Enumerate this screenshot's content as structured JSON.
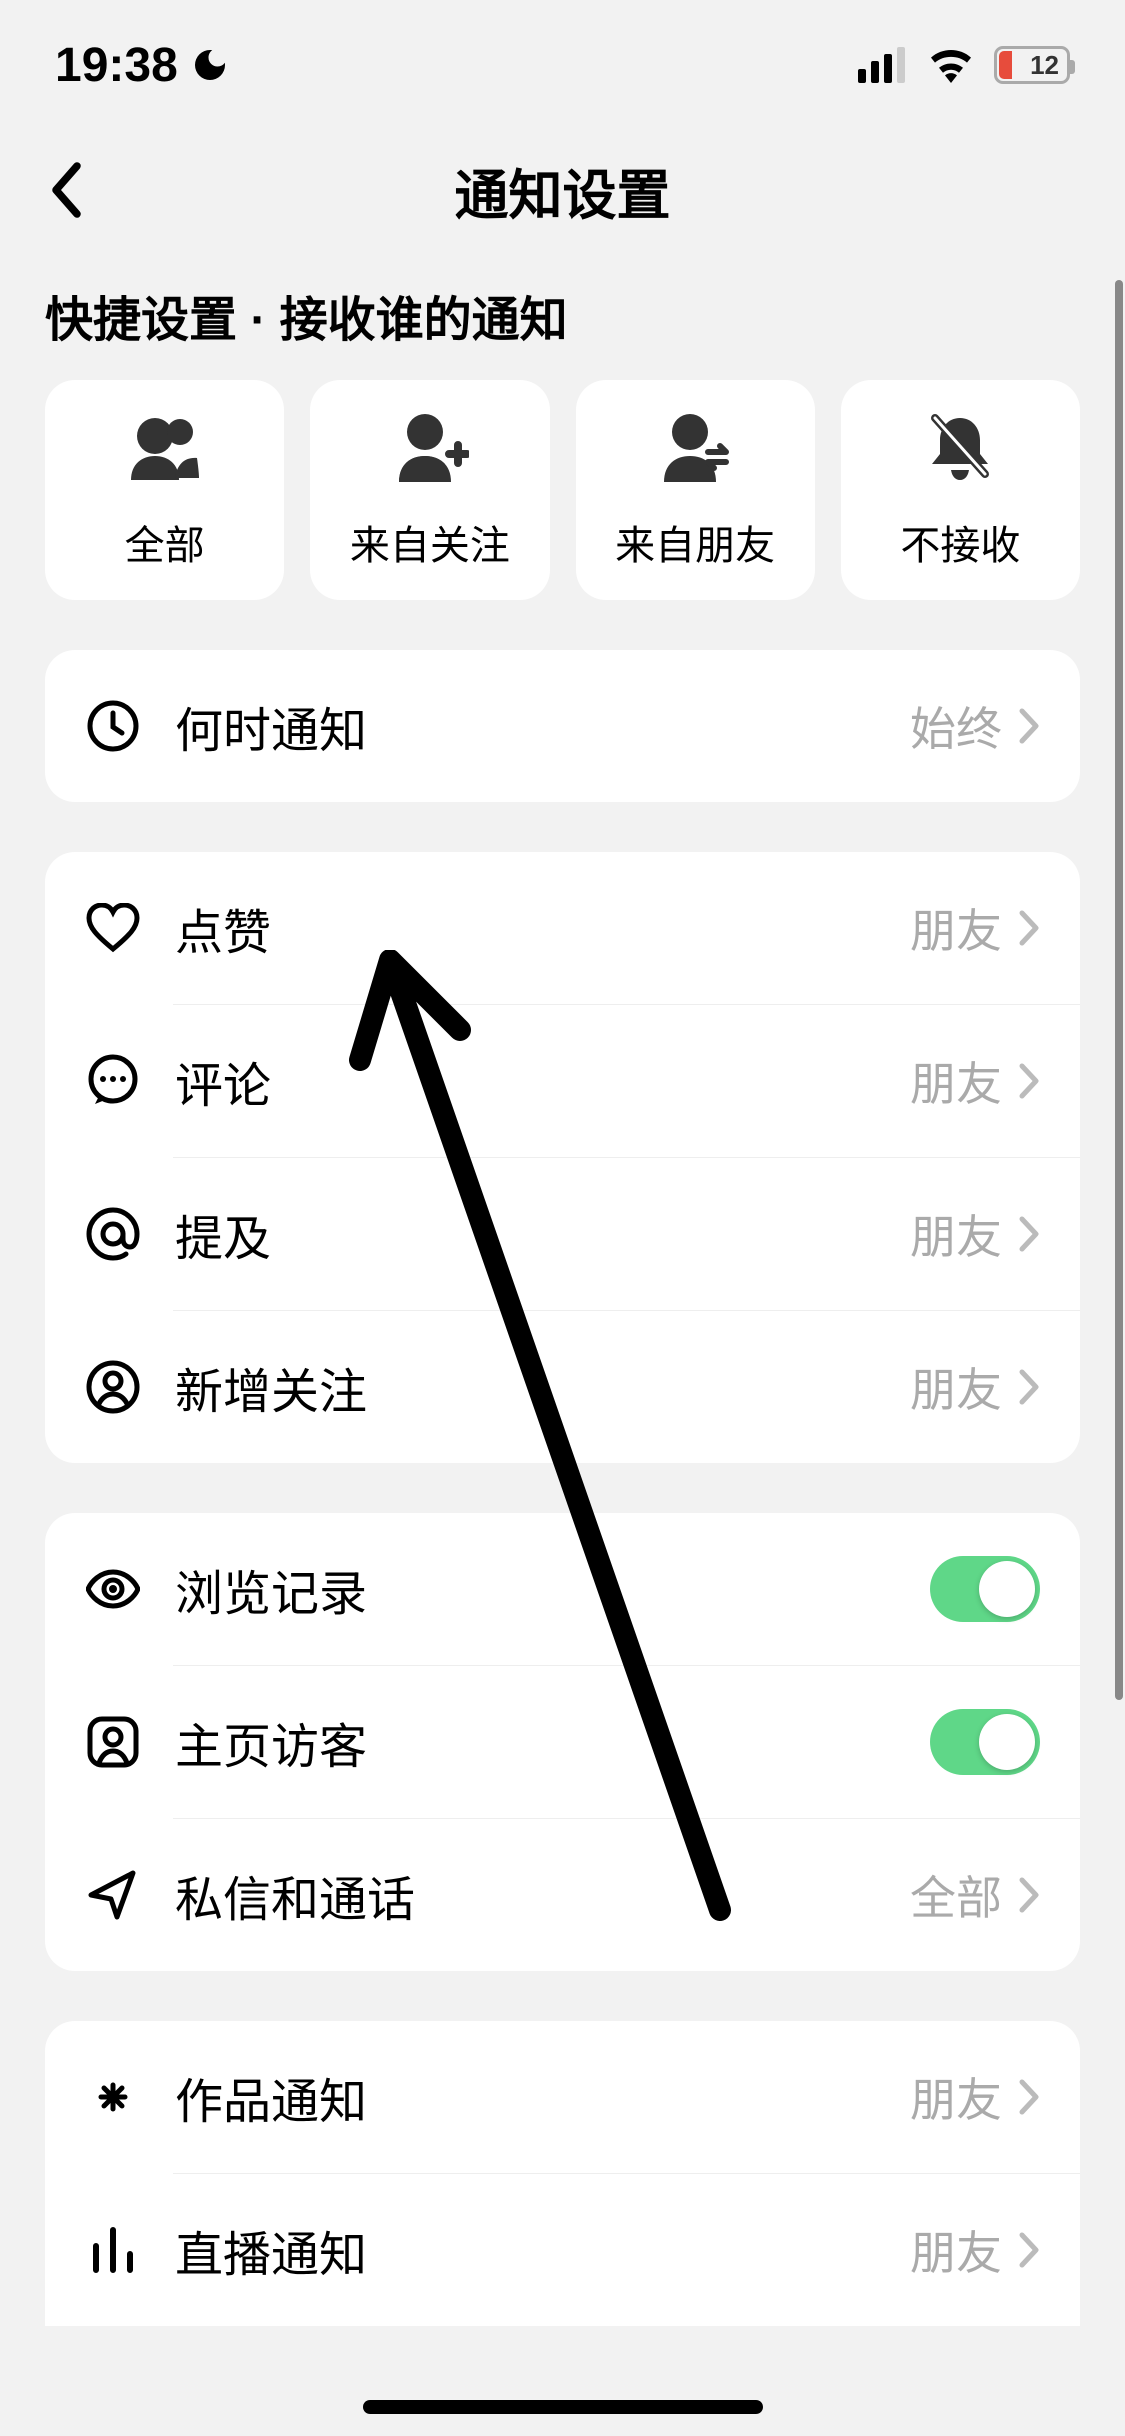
{
  "status": {
    "time": "19:38",
    "battery_pct": "12"
  },
  "header": {
    "title": "通知设置"
  },
  "section_header": "快捷设置 · 接收谁的通知",
  "quick": [
    {
      "label": "全部"
    },
    {
      "label": "来自关注"
    },
    {
      "label": "来自朋友"
    },
    {
      "label": "不接收"
    }
  ],
  "group1": {
    "row1_label": "何时通知",
    "row1_value": "始终"
  },
  "group2": {
    "like_label": "点赞",
    "like_value": "朋友",
    "comment_label": "评论",
    "comment_value": "朋友",
    "mention_label": "提及",
    "mention_value": "朋友",
    "follow_label": "新增关注",
    "follow_value": "朋友"
  },
  "group3": {
    "history_label": "浏览记录",
    "visitors_label": "主页访客",
    "dm_label": "私信和通话",
    "dm_value": "全部"
  },
  "group4": {
    "works_label": "作品通知",
    "works_value": "朋友",
    "live_label": "直播通知",
    "live_value": "朋友"
  }
}
